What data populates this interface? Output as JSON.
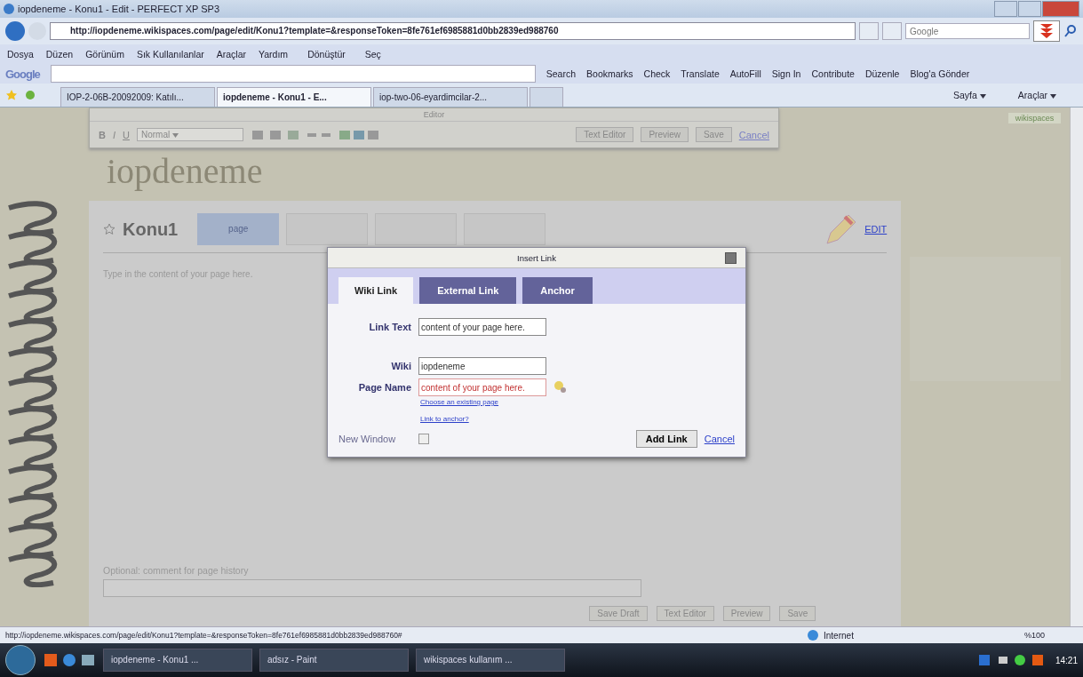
{
  "window": {
    "title": "iopdeneme - Konu1 - Edit - PERFECT XP SP3"
  },
  "address_bar": {
    "url": "http://iopdeneme.wikispaces.com/page/edit/Konu1?template=&responseToken=8fe761ef6985881d0bb2839ed988760",
    "search_placeholder": "Google"
  },
  "menu": [
    "Dosya",
    "Düzen",
    "Görünüm",
    "Sık Kullanılanlar",
    "Araçlar",
    "Yardım"
  ],
  "menu_extras": [
    "Dönüştür",
    "Seç"
  ],
  "google_toolbar": {
    "logo": "Google",
    "items": [
      "Search",
      "Bookmarks",
      "Check",
      "Translate",
      "AutoFill",
      "Sign In",
      "Contribute",
      "Düzenle",
      "Blog'a Gönder"
    ]
  },
  "tabs": [
    {
      "label": "IOP-2-06B-20092009: Katılı...",
      "selected": false
    },
    {
      "label": "iopdeneme - Konu1 - E...",
      "selected": true
    },
    {
      "label": "iop-two-06-eyardimcilar-2...",
      "selected": false
    }
  ],
  "command_bar": [
    "Sayfa",
    "Araçlar"
  ],
  "editor_toolbar": {
    "title": "Editor",
    "format_buttons": [
      "B",
      "I",
      "U"
    ],
    "format": "Normal",
    "buttons": [
      "Text Editor",
      "Preview",
      "Save"
    ],
    "cancel": "Cancel"
  },
  "wiki": {
    "name": "iopdeneme",
    "badge": "wikispaces"
  },
  "page": {
    "title": "Konu1",
    "tabs": [
      {
        "label": "page",
        "selected": true
      },
      {
        "selected": false
      },
      {
        "selected": false
      },
      {
        "selected": false
      }
    ],
    "edit": "EDIT",
    "body": "Type in the content of your page here.",
    "comment_label": "Optional: comment for page history",
    "bottom_buttons": [
      "Save Draft",
      "Text Editor",
      "Preview",
      "Save"
    ]
  },
  "dialog": {
    "title": "Insert Link",
    "tabs": [
      {
        "label": "Wiki Link",
        "selected": true
      },
      {
        "label": "External Link",
        "selected": false
      },
      {
        "label": "Anchor",
        "selected": false
      }
    ],
    "fields": [
      {
        "label": "Link Text",
        "value": "content of your page here.",
        "error": false
      },
      {
        "label": "Wiki",
        "value": "iopdeneme",
        "error": false
      },
      {
        "label": "Page Name",
        "value": "content of your page here.",
        "error": true
      }
    ],
    "links": [
      "Choose an existing page",
      "Link to anchor?"
    ],
    "new_window": {
      "label": "New Window",
      "checked": false
    },
    "add_button": "Add Link",
    "cancel": "Cancel"
  },
  "status_bar": {
    "url": "http://iopdeneme.wikispaces.com/page/edit/Konu1?template=&responseToken=8fe761ef6985881d0bb2839ed988760#",
    "zone": "Internet",
    "zoom": "%100"
  },
  "taskbar": {
    "items": [
      "iopdeneme - Konu1 ...",
      "adsız - Paint",
      "wikispaces kullanım ..."
    ],
    "clock": "14:21"
  }
}
